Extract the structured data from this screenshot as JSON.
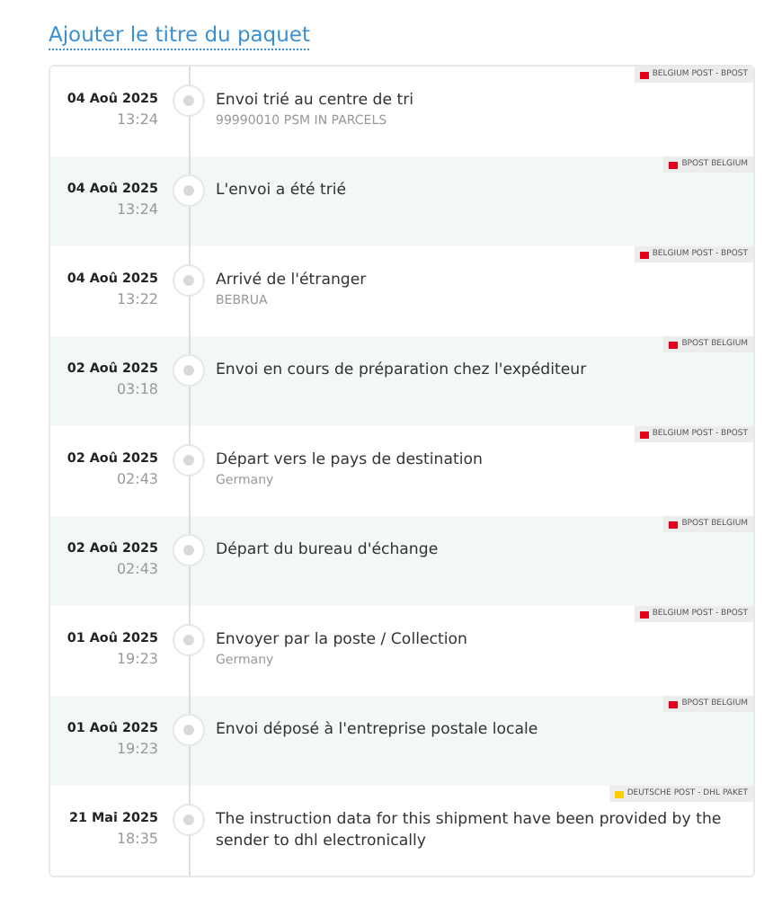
{
  "title_link": "Ajouter le titre du paquet",
  "events": [
    {
      "date": "04 Aoû 2025",
      "time": "13:24",
      "title": "Envoi trié au centre de tri",
      "detail": "99990010 PSM IN PARCELS",
      "carrier": "BELGIUM POST - BPOST",
      "color": "#e2001a"
    },
    {
      "date": "04 Aoû 2025",
      "time": "13:24",
      "title": "L'envoi a été trié",
      "carrier": "BPOST BELGIUM",
      "color": "#e2001a"
    },
    {
      "date": "04 Aoû 2025",
      "time": "13:22",
      "title": "Arrivé de l'étranger",
      "detail": "BEBRUA",
      "carrier": "BELGIUM POST - BPOST",
      "color": "#e2001a"
    },
    {
      "date": "02 Aoû 2025",
      "time": "03:18",
      "title": "Envoi en cours de préparation chez l'expéditeur",
      "carrier": "BPOST BELGIUM",
      "color": "#e2001a"
    },
    {
      "date": "02 Aoû 2025",
      "time": "02:43",
      "title": "Départ vers le pays de destination",
      "detail": "Germany",
      "carrier": "BELGIUM POST - BPOST",
      "color": "#e2001a"
    },
    {
      "date": "02 Aoû 2025",
      "time": "02:43",
      "title": "Départ du bureau d'échange",
      "carrier": "BPOST BELGIUM",
      "color": "#e2001a"
    },
    {
      "date": "01 Aoû 2025",
      "time": "19:23",
      "title": "Envoyer par la poste / Collection",
      "detail": "Germany",
      "carrier": "BELGIUM POST - BPOST",
      "color": "#e2001a"
    },
    {
      "date": "01 Aoû 2025",
      "time": "19:23",
      "title": "Envoi déposé à l'entreprise postale locale",
      "carrier": "BPOST BELGIUM",
      "color": "#e2001a"
    },
    {
      "date": "21 Mai 2025",
      "time": "18:35",
      "title": "The instruction data for this shipment have been provided by the sender to dhl electronically",
      "carrier": "DEUTSCHE POST - DHL PAKET",
      "color": "#ffcc00"
    }
  ]
}
